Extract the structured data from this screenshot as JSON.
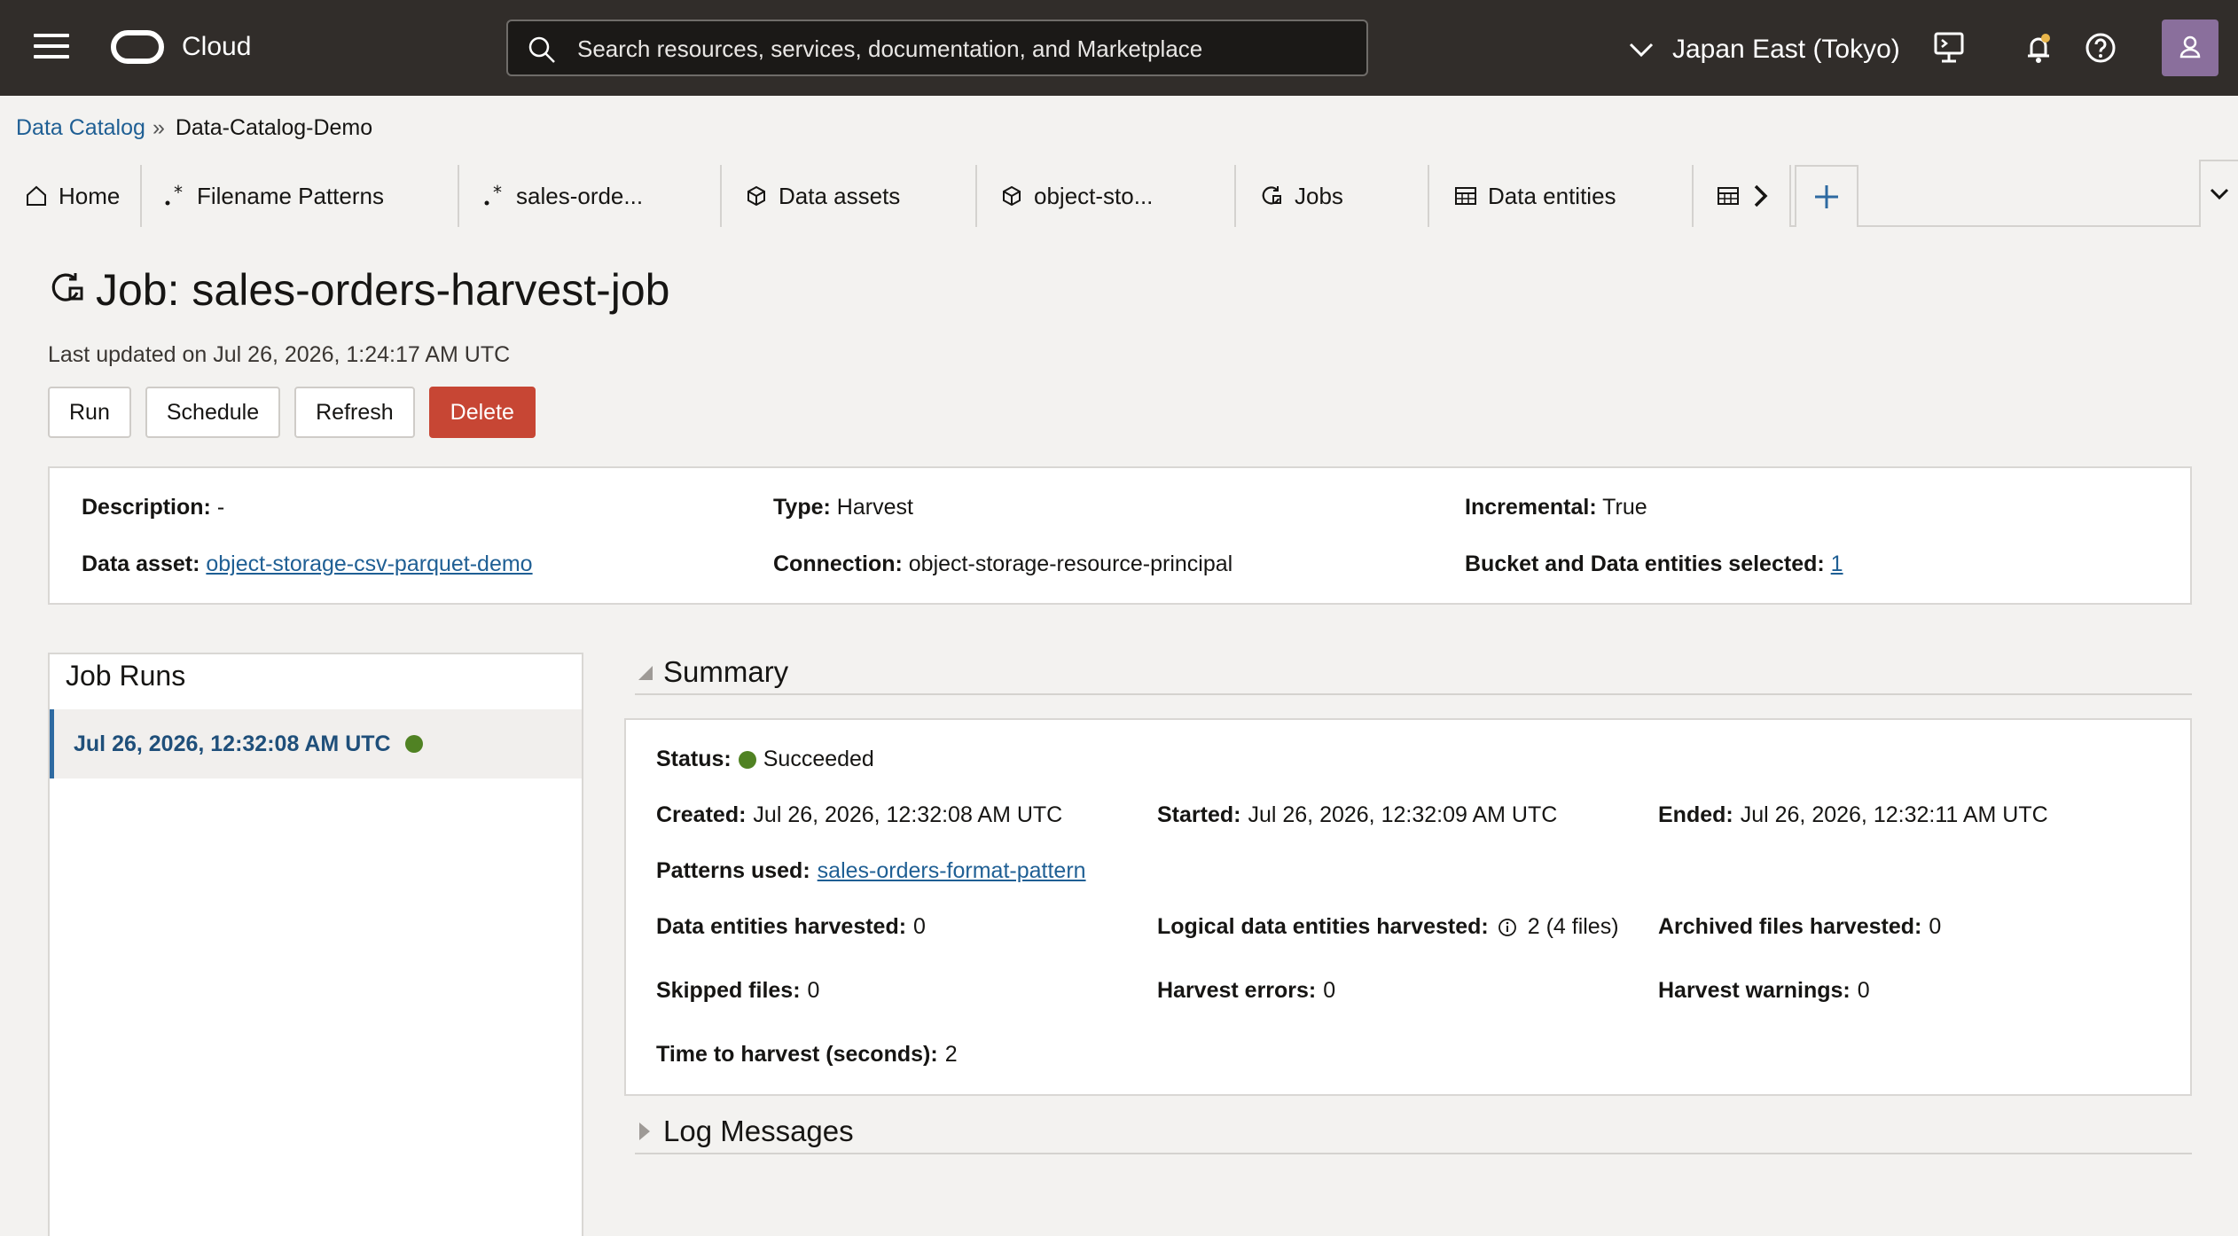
{
  "header": {
    "brand": "Cloud",
    "search_placeholder": "Search resources, services, documentation, and Marketplace",
    "region": "Japan East (Tokyo)"
  },
  "breadcrumb": {
    "root": "Data Catalog",
    "separator": "»",
    "current": "Data-Catalog-Demo"
  },
  "tabs": [
    {
      "label": "Home",
      "icon": "home-icon"
    },
    {
      "label": "Filename Patterns",
      "icon": "regex-icon"
    },
    {
      "label": "sales-orde...",
      "icon": "regex-icon"
    },
    {
      "label": "Data assets",
      "icon": "cube-icon"
    },
    {
      "label": "object-sto...",
      "icon": "cube-icon"
    },
    {
      "label": "Jobs",
      "icon": "job-icon"
    },
    {
      "label": "Data entities",
      "icon": "table-icon"
    }
  ],
  "page": {
    "title": "Job: sales-orders-harvest-job",
    "last_updated": "Last updated on Jul 26, 2026, 1:24:17 AM UTC",
    "buttons": {
      "run": "Run",
      "schedule": "Schedule",
      "refresh": "Refresh",
      "delete": "Delete"
    }
  },
  "details": {
    "description_label": "Description:",
    "description_value": "-",
    "type_label": "Type:",
    "type_value": "Harvest",
    "incremental_label": "Incremental:",
    "incremental_value": "True",
    "data_asset_label": "Data asset:",
    "data_asset_value": "object-storage-csv-parquet-demo",
    "connection_label": "Connection:",
    "connection_value": "object-storage-resource-principal",
    "bucket_label": "Bucket and Data entities selected:",
    "bucket_value": "1"
  },
  "job_runs": {
    "title": "Job Runs",
    "items": [
      {
        "label": "Jul 26, 2026, 12:32:08 AM UTC",
        "status_color": "#508223"
      }
    ]
  },
  "summary": {
    "title": "Summary",
    "status_label": "Status:",
    "status_value": "Succeeded",
    "created_label": "Created:",
    "created_value": "Jul 26, 2026, 12:32:08 AM UTC",
    "started_label": "Started:",
    "started_value": "Jul 26, 2026, 12:32:09 AM UTC",
    "ended_label": "Ended:",
    "ended_value": "Jul 26, 2026, 12:32:11 AM UTC",
    "patterns_label": "Patterns used:",
    "patterns_value": "sales-orders-format-pattern",
    "de_harvested_label": "Data entities harvested:",
    "de_harvested_value": "0",
    "lde_harvested_label": "Logical data entities harvested:",
    "lde_harvested_value": "2 (4 files)",
    "archived_label": "Archived files harvested:",
    "archived_value": "0",
    "skipped_label": "Skipped files:",
    "skipped_value": "0",
    "errors_label": "Harvest errors:",
    "errors_value": "0",
    "warnings_label": "Harvest warnings:",
    "warnings_value": "0",
    "time_label": "Time to harvest (seconds):",
    "time_value": "2"
  },
  "log_messages": {
    "title": "Log Messages"
  },
  "colors": {
    "header_bg": "#312d2a",
    "danger": "#c74634",
    "success": "#508223",
    "link": "#1f5f94"
  }
}
